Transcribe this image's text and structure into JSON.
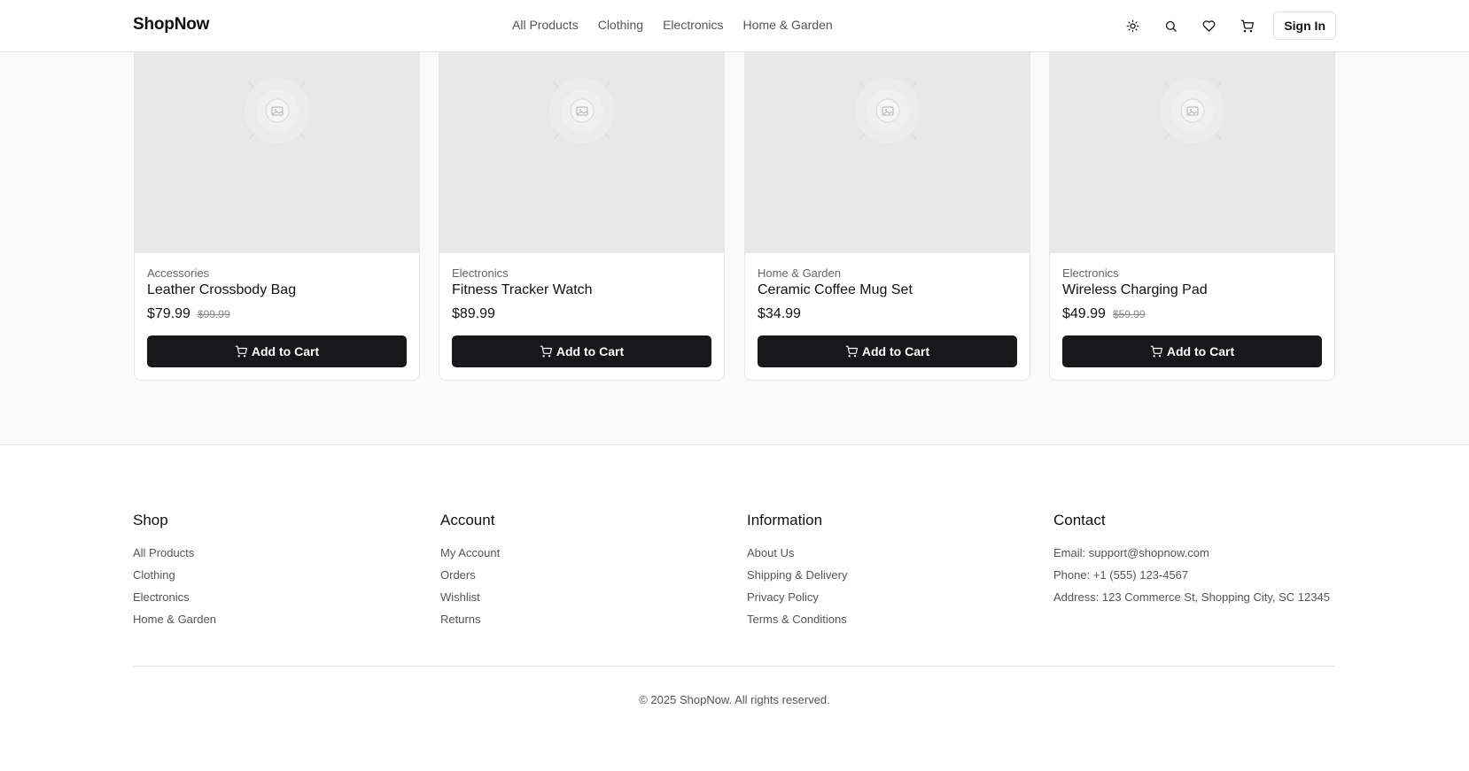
{
  "header": {
    "logo": "ShopNow",
    "nav": [
      "All Products",
      "Clothing",
      "Electronics",
      "Home & Garden"
    ],
    "icons": [
      "sun-icon",
      "search-icon",
      "heart-icon",
      "cart-icon"
    ],
    "signin_label": "Sign In"
  },
  "products": [
    {
      "category": "Accessories",
      "name": "Leather Crossbody Bag",
      "price": "$79.99",
      "old_price": "$99.99",
      "button": "Add to Cart"
    },
    {
      "category": "Electronics",
      "name": "Fitness Tracker Watch",
      "price": "$89.99",
      "old_price": "",
      "button": "Add to Cart"
    },
    {
      "category": "Home & Garden",
      "name": "Ceramic Coffee Mug Set",
      "price": "$34.99",
      "old_price": "",
      "button": "Add to Cart"
    },
    {
      "category": "Electronics",
      "name": "Wireless Charging Pad",
      "price": "$49.99",
      "old_price": "$59.99",
      "button": "Add to Cart"
    }
  ],
  "footer": {
    "columns": [
      {
        "title": "Shop",
        "items": [
          "All Products",
          "Clothing",
          "Electronics",
          "Home & Garden"
        ]
      },
      {
        "title": "Account",
        "items": [
          "My Account",
          "Orders",
          "Wishlist",
          "Returns"
        ]
      },
      {
        "title": "Information",
        "items": [
          "About Us",
          "Shipping & Delivery",
          "Privacy Policy",
          "Terms & Conditions"
        ]
      },
      {
        "title": "Contact",
        "items": [
          "Email: support@shopnow.com",
          "Phone: +1 (555) 123-4567",
          "Address: 123 Commerce St, Shopping City, SC 12345"
        ]
      }
    ],
    "copyright": "© 2025 ShopNow. All rights reserved."
  },
  "colors": {
    "primary_button": "#18181b",
    "image_placeholder": "#e8e8e8",
    "page_background": "#fafafa"
  }
}
